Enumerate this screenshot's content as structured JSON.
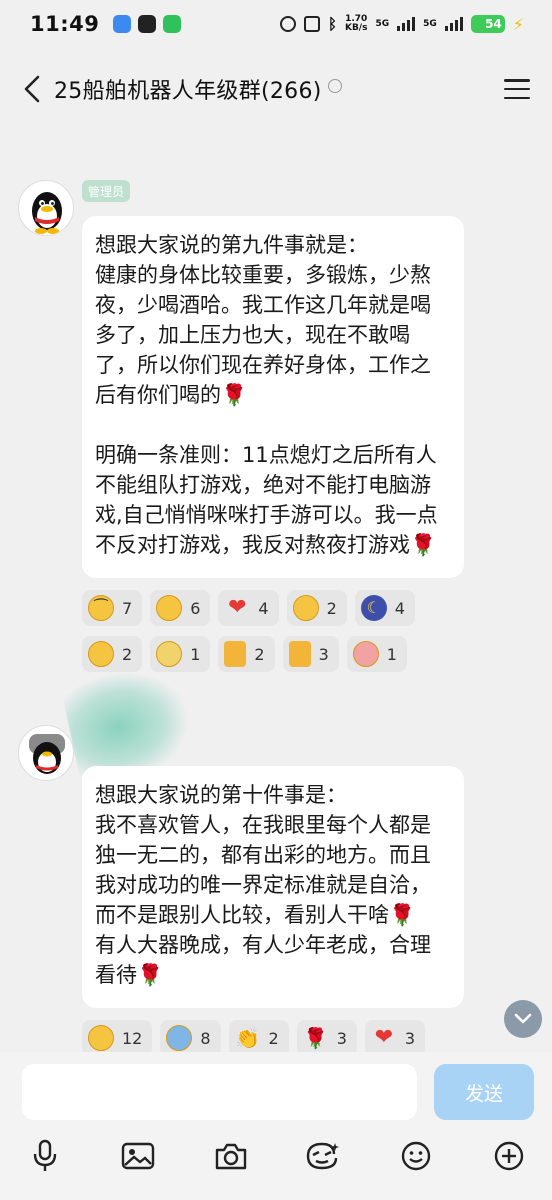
{
  "status_bar": {
    "time": "11:49",
    "net_speed": "1.70",
    "net_unit": "KB/s",
    "sim1_label": "5G",
    "sim2_label": "5G",
    "battery": "54"
  },
  "header": {
    "title": "25船舶机器人年级群(266)"
  },
  "messages": [
    {
      "role_tag": "管理员",
      "text": "想跟大家说的第九件事就是：\n健康的身体比较重要，多锻炼，少熬夜，少喝酒哈。我工作这几年就是喝多了，加上压力也大，现在不敢喝了，所以你们现在养好身体，工作之后有你们喝的🌹\n\n明确一条准则：11点熄灯之后所有人不能组队打游戏，绝对不能打电脑游戏,自己悄悄咪咪打手游可以。我一点不反对打游戏，我反对熬夜打游戏🌹",
      "reactions": [
        {
          "icon": "smirk-face-icon",
          "count": "7"
        },
        {
          "icon": "rose-hug-face-icon",
          "count": "6"
        },
        {
          "icon": "heart-icon",
          "count": "4"
        },
        {
          "icon": "blush-face-icon",
          "count": "2"
        },
        {
          "icon": "moon-icon",
          "count": "4"
        },
        {
          "icon": "sly-face-icon",
          "count": "2"
        },
        {
          "icon": "sweat-face-icon",
          "count": "1"
        },
        {
          "icon": "beer-icon",
          "count": "2"
        },
        {
          "icon": "cheers-icon",
          "count": "3"
        },
        {
          "icon": "scared-face-icon",
          "count": "1"
        }
      ]
    },
    {
      "text": "想跟大家说的第十件事是：\n我不喜欢管人，在我眼里每个人都是独一无二的，都有出彩的地方。而且我对成功的唯一界定标准就是自洽，而不是跟别人比较，看别人干啥🌹\n有人大器晚成，有人少年老成，合理看待🌹",
      "reactions": [
        {
          "icon": "sly-face-icon",
          "count": "12"
        },
        {
          "icon": "crying-face-icon",
          "count": "8"
        },
        {
          "icon": "clap-icon",
          "count": "2"
        },
        {
          "icon": "rose-icon",
          "count": "3"
        },
        {
          "icon": "heart-icon",
          "count": "3"
        }
      ]
    }
  ],
  "composer": {
    "placeholder": "",
    "send_label": "发送"
  },
  "toolbar": [
    "voice-icon",
    "image-icon",
    "camera-icon",
    "sticker-icon",
    "emoji-icon",
    "plus-icon"
  ]
}
